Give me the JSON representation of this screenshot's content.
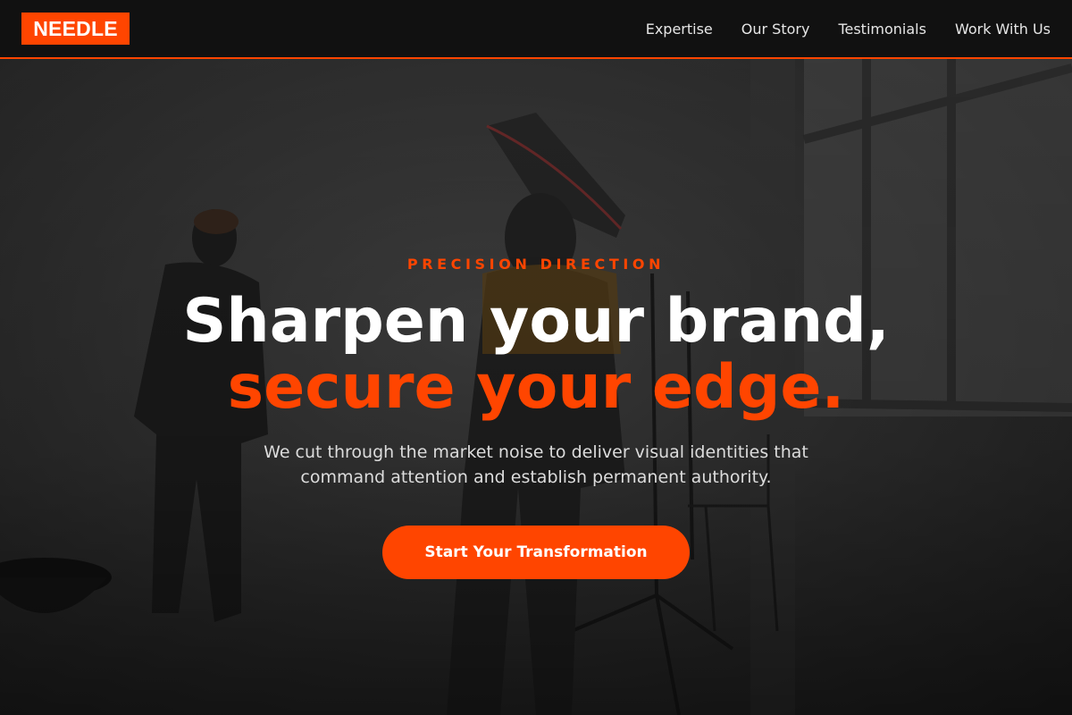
{
  "brand": {
    "logo": "NEEDLE",
    "accent": "#ff4500"
  },
  "nav": {
    "items": [
      {
        "label": "Expertise"
      },
      {
        "label": "Our Story"
      },
      {
        "label": "Testimonials"
      },
      {
        "label": "Work With Us"
      }
    ]
  },
  "hero": {
    "eyebrow": "PRECISION DIRECTION",
    "headline_line1": "Sharpen your brand,",
    "headline_line2": "secure your edge.",
    "subtitle": "We cut through the market noise to deliver visual identities that command attention and establish permanent authority.",
    "cta_label": "Start Your Transformation",
    "background_image": "photo-studio-scene"
  }
}
